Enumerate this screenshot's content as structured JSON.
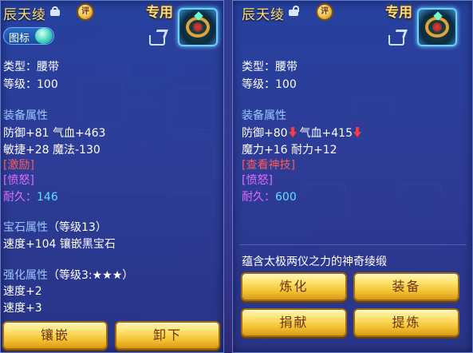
{
  "left": {
    "name": "辰天绫",
    "medal": "评",
    "special": "专用",
    "icon_toggle_label": "图标",
    "type_line": "类型：腰带",
    "level_line": "等级：100",
    "equip_attr_title": "装备属性",
    "stats_line1": "防御+81 气血+463",
    "stats_line2": "敏捷+28 魔法-130",
    "effect1": "[激励]",
    "effect2": "[愤怒]",
    "durability_label": "耐久：",
    "durability_value": "146",
    "gem_title": "宝石属性",
    "gem_level": "（等级13）",
    "gem_line": "速度+104 镶嵌黑宝石",
    "strengthen_title": "强化属性",
    "strengthen_level": "（等级3:★★★）",
    "strengthen_line1": "速度+2",
    "strengthen_line2": "速度+3",
    "btn_inlay": "镶嵌",
    "btn_unequip": "卸下"
  },
  "right": {
    "name": "辰天绫",
    "medal": "评",
    "special": "专用",
    "type_line": "类型：腰带",
    "level_line": "等级：100",
    "equip_attr_title": "装备属性",
    "stat_def": "防御+80",
    "stat_hp": "气血+415",
    "stats_line2": "魔力+16 耐力+12",
    "effect1": "[查看神技]",
    "effect2": "[愤怒]",
    "durability_label": "耐久：",
    "durability_value": "600",
    "description": "蕴含太极两仪之力的神奇绫缎",
    "btn_refine": "炼化",
    "btn_equip": "装备",
    "btn_donate": "捐献",
    "btn_extract": "提炼"
  },
  "colors": {
    "title_gold": "#ffe07a",
    "section_blue": "#9cc6ff",
    "effect_red": "#ff5a5a",
    "effect_pink": "#e56bff",
    "durability_cyan": "#4fe8ff",
    "button_gold": "#f0c030"
  },
  "icons": [
    "lock-icon",
    "unlock-icon",
    "medal-icon",
    "share-icon",
    "belt-item-icon",
    "down-arrow-icon"
  ]
}
